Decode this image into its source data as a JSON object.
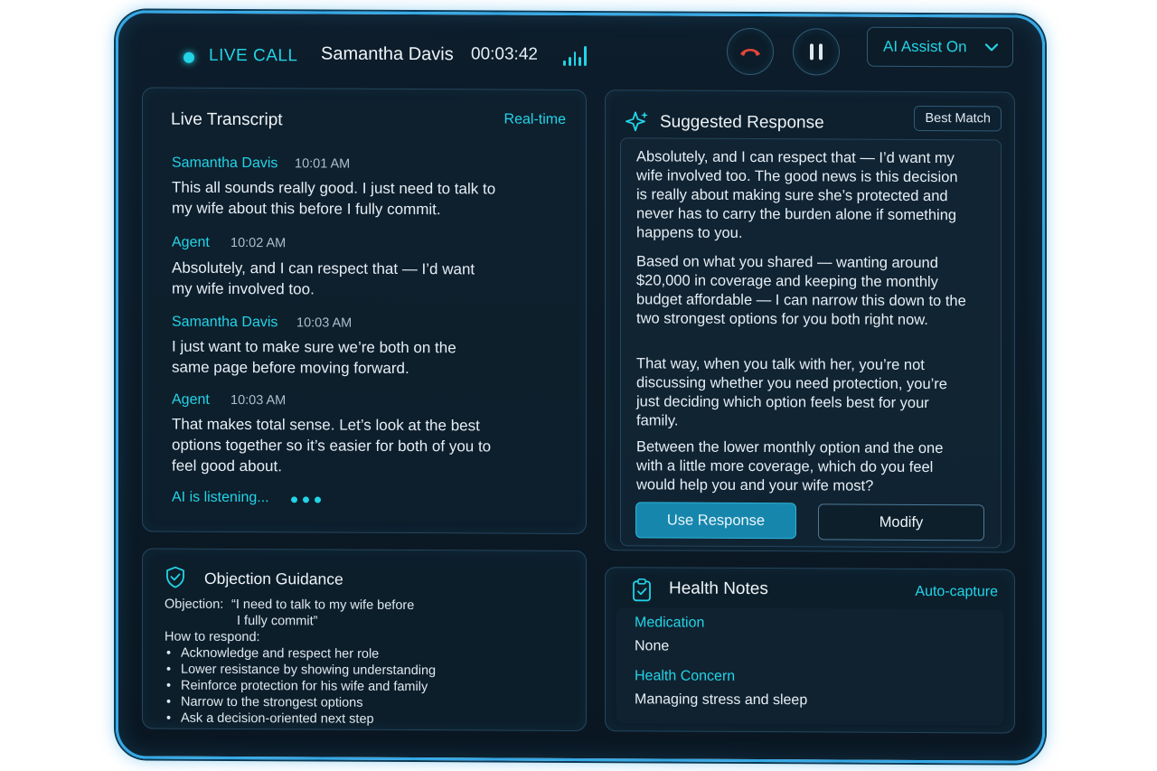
{
  "topbar": {
    "live_label": "LIVE CALL",
    "caller_name": "Samantha Davis",
    "timer": "00:03:42",
    "assist_label": "AI Assist On"
  },
  "transcript": {
    "title": "Live Transcript",
    "tag": "Real-time",
    "messages": [
      {
        "speaker": "Samantha Davis",
        "time": "10:01 AM",
        "text": "This all sounds really good. I just need to talk to my wife about this before I fully commit."
      },
      {
        "speaker": "Agent",
        "time": "10:02 AM",
        "text": "Absolutely, and I can respect that — I’d want my wife involved too."
      },
      {
        "speaker": "Samantha Davis",
        "time": "10:03 AM",
        "text": "I just want to make sure we’re both on the same page before moving forward."
      },
      {
        "speaker": "Agent",
        "time": "10:03 AM",
        "text": "That makes total sense. Let’s look at the best options together so it’s easier for both of you to feel good about."
      }
    ],
    "listening": "AI is listening..."
  },
  "suggested": {
    "title": "Suggested Response",
    "badge": "Best Match",
    "paragraphs": [
      "Absolutely, and I can respect that — I’d want my wife involved too. The good news is this decision is really about making sure she’s protected and never has to carry the burden alone if something happens to you.",
      "Based on what you shared — wanting around $20,000 in coverage and keeping the monthly budget affordable — I can narrow this down to the two strongest options for you both right now.",
      "That way, when you talk with her, you’re not discussing whether you need protection, you’re just deciding which option feels best for your family.",
      "Between the lower monthly option and the one with a little more coverage, which do you feel would help you and your wife most?"
    ],
    "use_label": "Use Response",
    "modify_label": "Modify"
  },
  "objection": {
    "title": "Objection Guidance",
    "objection_label": "Objection:",
    "objection_line1": "“I need to talk to my wife before",
    "objection_line2": "I fully commit”",
    "how_label": "How to respond:",
    "bullets": [
      "Acknowledge and respect her role",
      "Lower resistance by showing understanding",
      "Reinforce protection for his wife and family",
      "Narrow to the strongest options",
      "Ask a decision-oriented next step"
    ]
  },
  "health": {
    "title": "Health Notes",
    "tag": "Auto-capture",
    "items": [
      {
        "label": "Medication",
        "value": "None"
      },
      {
        "label": "Health Concern",
        "value": "Managing stress and sleep"
      }
    ]
  },
  "colors": {
    "accent": "#23d3e6",
    "frame": "#36a9e6",
    "hangup": "#e2463a",
    "primary_button": "#1786ad"
  },
  "icons": [
    "signal-wave-icon",
    "phone-hangup-icon",
    "pause-icon",
    "chevron-down-icon",
    "sparkle-icon",
    "shield-check-icon",
    "clipboard-check-icon"
  ]
}
